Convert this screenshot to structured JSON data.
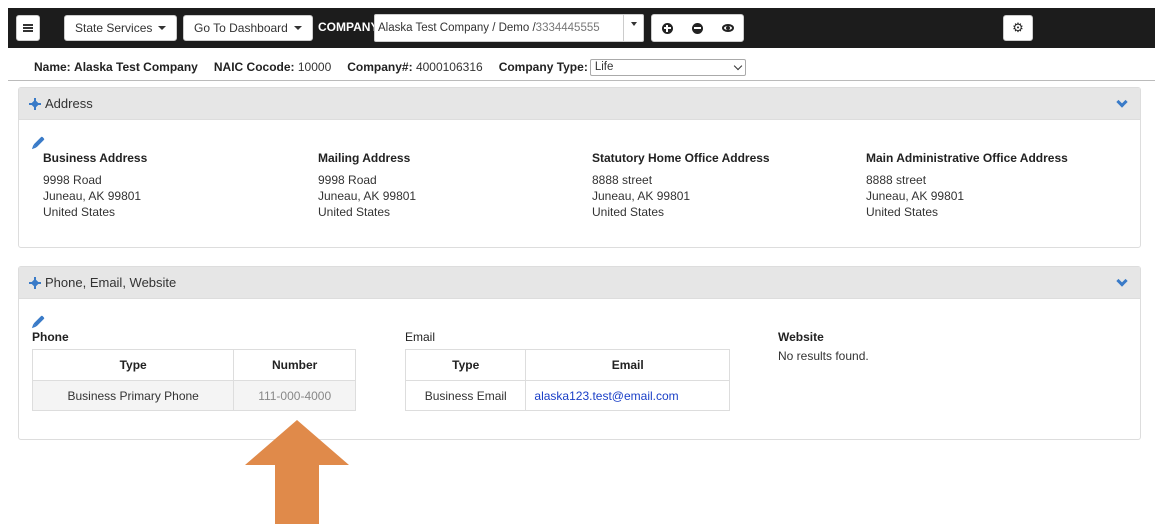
{
  "navbar": {
    "state_services_label": "State Services",
    "dashboard_label": "Go To Dashboard",
    "company_label": "COMPANY:",
    "company_name": "Alaska Test Company / Demo /",
    "company_number": "3334445555"
  },
  "info": {
    "name_label": "Name:",
    "name_value": "Alaska Test Company",
    "naic_label": "NAIC Cocode:",
    "naic_value": "10000",
    "company_num_label": "Company#:",
    "company_num_value": "4000106316",
    "type_label": "Company Type:",
    "type_value": "Life"
  },
  "address_panel": {
    "title": "Address",
    "columns": [
      {
        "heading": "Business Address",
        "line1": "9998 Road",
        "line2": "Juneau, AK 99801",
        "line3": "United States"
      },
      {
        "heading": "Mailing Address",
        "line1": "9998 Road",
        "line2": "Juneau, AK 99801",
        "line3": "United States"
      },
      {
        "heading": "Statutory Home Office Address",
        "line1": "8888 street",
        "line2": "Juneau, AK 99801",
        "line3": "United States"
      },
      {
        "heading": "Main Administrative Office Address",
        "line1": "8888 street",
        "line2": "Juneau, AK 99801",
        "line3": "United States"
      }
    ]
  },
  "contact_panel": {
    "title": "Phone, Email, Website",
    "phone_label": "Phone",
    "phone_headers": [
      "Type",
      "Number"
    ],
    "phone_rows": [
      [
        "Business Primary Phone",
        "111-000-4000"
      ]
    ],
    "email_label": "Email",
    "email_headers": [
      "Type",
      "Email"
    ],
    "email_rows": [
      [
        "Business Email",
        "alaska123.test@email.com"
      ]
    ],
    "website_label": "Website",
    "website_empty": "No results found."
  },
  "colors": {
    "accent": "#3a7bc8",
    "arrow": "#e08a4a",
    "navbar": "#1c1c1c",
    "link": "#1a3fc7"
  }
}
